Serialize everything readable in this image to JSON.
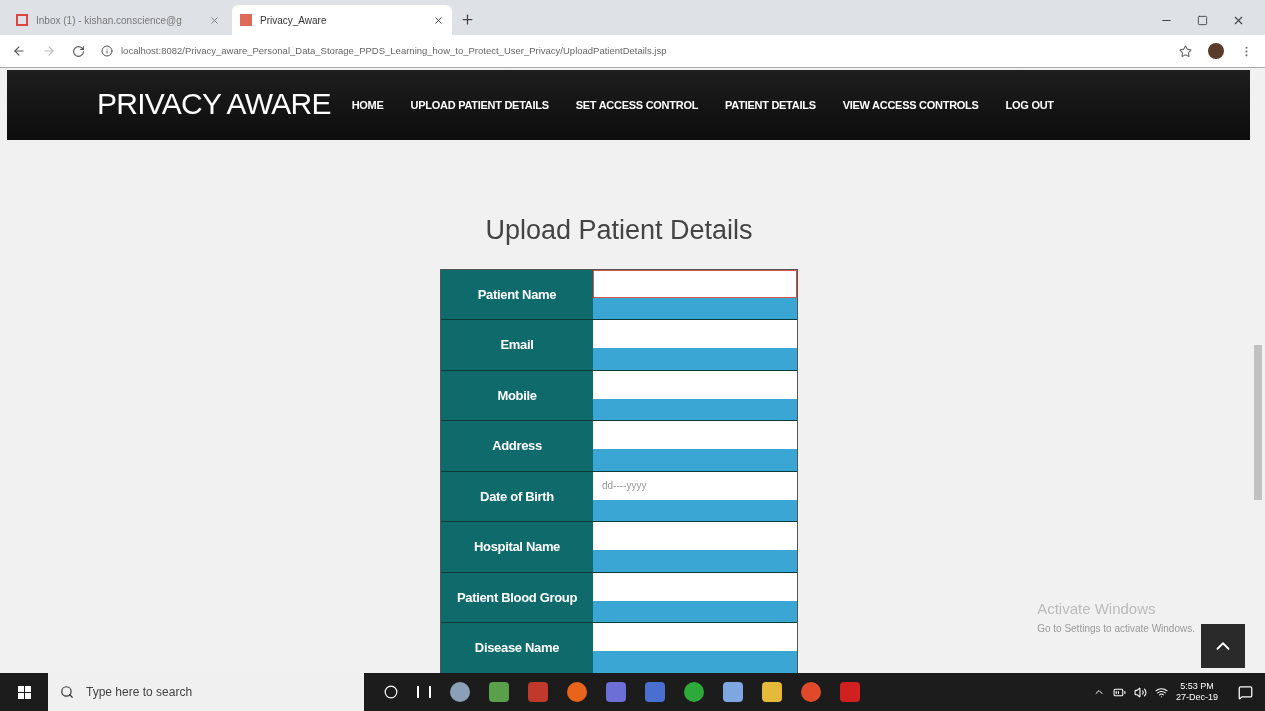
{
  "browser": {
    "tabs": [
      {
        "title": "Inbox (1) - kishan.conscience@g",
        "kind": "mail",
        "selected": false
      },
      {
        "title": "Privacy_Aware",
        "kind": "site",
        "selected": true
      }
    ],
    "address": "localhost:8082/Privacy_aware_Personal_Data_Storage_PPDS_Learning_how_to_Protect_User_Privacy/UploadPatientDetails.jsp"
  },
  "navbar": {
    "brand": "PRIVACY AWARE",
    "items": [
      "HOME",
      "UPLOAD PATIENT DETAILS",
      "SET ACCESS CONTROL",
      "PATIENT DETAILS",
      "VIEW ACCESS CONTROLS",
      "LOG OUT"
    ]
  },
  "page": {
    "title": "Upload Patient Details",
    "fields": [
      {
        "label": "Patient Name",
        "focused": true
      },
      {
        "label": "Email",
        "focused": false
      },
      {
        "label": "Mobile",
        "focused": false
      },
      {
        "label": "Address",
        "focused": false
      },
      {
        "label": "Date of Birth",
        "focused": false,
        "placeholder": "dd----yyyy"
      },
      {
        "label": "Hospital Name",
        "focused": false
      },
      {
        "label": "Patient Blood Group",
        "focused": false
      },
      {
        "label": "Disease Name",
        "focused": false
      }
    ]
  },
  "activation_notice": {
    "title": "Activate Windows",
    "text": "Go to Settings to activate Windows."
  },
  "taskbar": {
    "search_placeholder": "Type here to search",
    "time": "5:53 PM",
    "date": "27-Dec-19"
  }
}
